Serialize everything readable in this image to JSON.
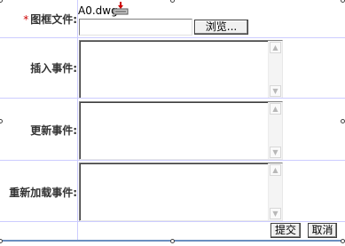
{
  "form": {
    "required_mark": "*",
    "file_label": "图框文件:",
    "current_file": "A0.dwg",
    "browse_label": "浏览...",
    "insert_label": "插入事件:",
    "update_label": "更新事件:",
    "reload_label": "重新加载事件:",
    "submit_label": "提交",
    "cancel_label": "取消"
  },
  "icons": {
    "download": "download-icon",
    "scroll_up": "chevron-up-icon",
    "scroll_down": "chevron-down-icon"
  },
  "colors": {
    "separator": "#ccccff",
    "required": "#cc0000",
    "accent_bar": "#6a8fc0"
  }
}
